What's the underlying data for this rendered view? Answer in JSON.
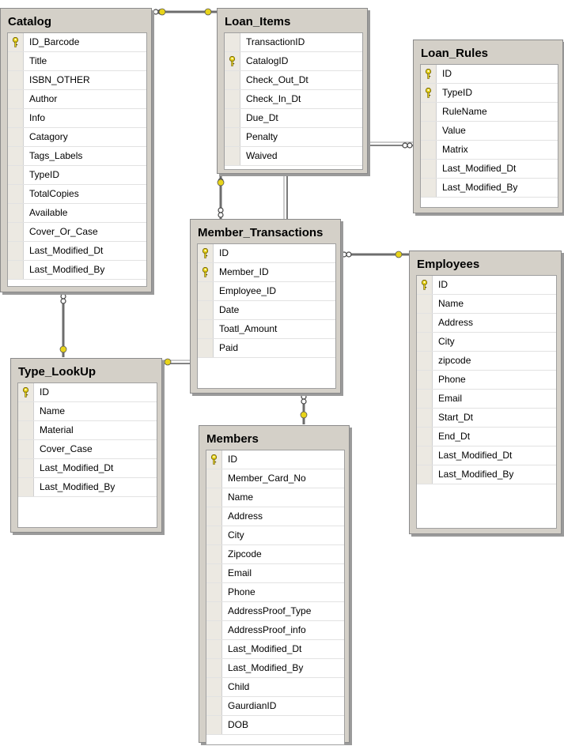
{
  "tables": {
    "catalog": {
      "title": "Catalog",
      "columns": [
        "ID_Barcode",
        "Title",
        "ISBN_OTHER",
        "Author",
        "Info",
        "Catagory",
        "Tags_Labels",
        "TypeID",
        "TotalCopies",
        "Available",
        "Cover_Or_Case",
        "Last_Modified_Dt",
        "Last_Modified_By"
      ],
      "keys": [
        0
      ]
    },
    "loan_items": {
      "title": "Loan_Items",
      "columns": [
        "TransactionID",
        "CatalogID",
        "Check_Out_Dt",
        "Check_In_Dt",
        "Due_Dt",
        "Penalty",
        "Waived"
      ],
      "keys": [
        1
      ]
    },
    "loan_rules": {
      "title": "Loan_Rules",
      "columns": [
        "ID",
        "TypeID",
        "RuleName",
        "Value",
        "Matrix",
        "Last_Modified_Dt",
        "Last_Modified_By"
      ],
      "keys": [
        0,
        1
      ]
    },
    "member_transactions": {
      "title": "Member_Transactions",
      "columns": [
        "ID",
        "Member_ID",
        "Employee_ID",
        "Date",
        "Toatl_Amount",
        "Paid"
      ],
      "keys": [
        0,
        1
      ]
    },
    "employees": {
      "title": "Employees",
      "columns": [
        "ID",
        "Name",
        "Address",
        "City",
        "zipcode",
        "Phone",
        "Email",
        "Start_Dt",
        "End_Dt",
        "Last_Modified_Dt",
        "Last_Modified_By"
      ],
      "keys": [
        0
      ]
    },
    "type_lookup": {
      "title": "Type_LookUp",
      "columns": [
        "ID",
        "Name",
        "Material",
        "Cover_Case",
        "Last_Modified_Dt",
        "Last_Modified_By"
      ],
      "keys": [
        0
      ]
    },
    "members": {
      "title": "Members",
      "columns": [
        "ID",
        "Member_Card_No",
        "Name",
        "Address",
        "City",
        "Zipcode",
        "Email",
        "Phone",
        "AddressProof_Type",
        "AddressProof_info",
        "Last_Modified_Dt",
        "Last_Modified_By",
        "Child",
        "GaurdianID",
        "DOB"
      ],
      "keys": [
        0
      ]
    }
  },
  "relationships": [
    {
      "from": "catalog",
      "to": "loan_items"
    },
    {
      "from": "loan_items",
      "to": "member_transactions"
    },
    {
      "from": "catalog",
      "to": "type_lookup"
    },
    {
      "from": "type_lookup",
      "to": "loan_rules"
    },
    {
      "from": "member_transactions",
      "to": "employees"
    },
    {
      "from": "member_transactions",
      "to": "members"
    }
  ],
  "colors": {
    "window": "#d4d0c8",
    "key": "#e8d41a",
    "line": "#6a6a6a"
  }
}
